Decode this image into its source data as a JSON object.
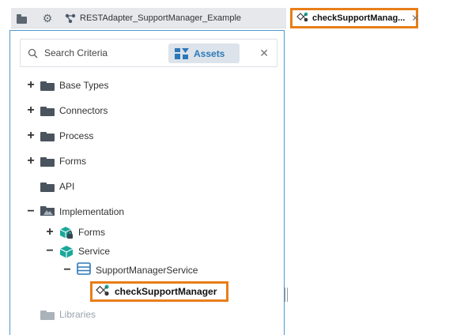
{
  "toolbar": {
    "project_name": "RESTAdapter_SupportManager_Example"
  },
  "editor_tab": {
    "label": "checkSupportManag..."
  },
  "search": {
    "placeholder": "Search Criteria",
    "assets_label": "Assets"
  },
  "tree": {
    "base_types": "Base Types",
    "connectors": "Connectors",
    "process": "Process",
    "forms": "Forms",
    "api": "API",
    "implementation": "Implementation",
    "impl_forms": "Forms",
    "service": "Service",
    "support_manager_service": "SupportManagerService",
    "check_support_manager": "checkSupportManager",
    "libraries": "Libraries"
  },
  "colors": {
    "highlight": "#e87e18",
    "panel_border": "#4e98d1",
    "accent": "#2c78b8",
    "teal": "#1aa89a"
  }
}
